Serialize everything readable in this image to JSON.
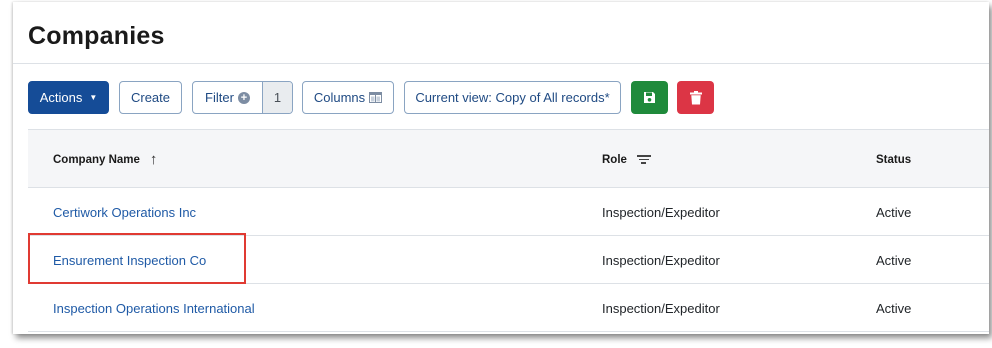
{
  "page": {
    "title": "Companies"
  },
  "toolbar": {
    "actions_label": "Actions",
    "actions_caret": "▼",
    "create_label": "Create",
    "filter_label": "Filter",
    "filter_count": "1",
    "columns_label": "Columns",
    "current_view_label": "Current view: Copy of All records*",
    "save_icon": "save-icon",
    "delete_icon": "trash-icon",
    "colors": {
      "primary": "#154c97",
      "save": "#1f8a3b",
      "delete": "#dc3545"
    }
  },
  "table": {
    "columns": [
      {
        "label": "Company Name",
        "sort": "ascending"
      },
      {
        "label": "Role",
        "filter": true
      },
      {
        "label": "Status"
      }
    ],
    "rows": [
      {
        "company": "Certiwork Operations Inc",
        "role": "Inspection/Expeditor",
        "status": "Active"
      },
      {
        "company": "Ensurement Inspection Co",
        "role": "Inspection/Expeditor",
        "status": "Active",
        "highlighted": true
      },
      {
        "company": "Inspection Operations International",
        "role": "Inspection/Expeditor",
        "status": "Active"
      }
    ]
  },
  "highlight_color": "#e03a32"
}
